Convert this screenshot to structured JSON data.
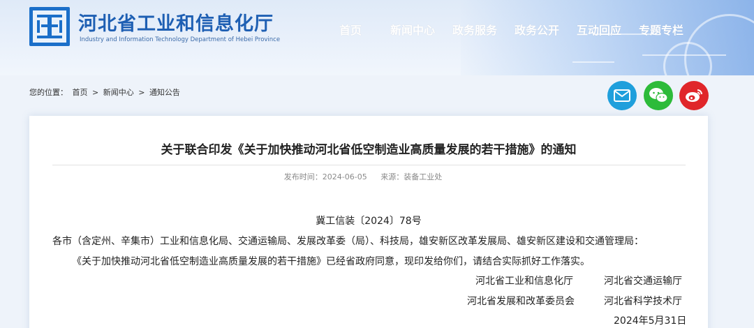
{
  "header": {
    "logo_cn": "河北省工业和信息化厅",
    "logo_en": "Industry and Information Technology Department of Hebei Province",
    "nav": [
      {
        "label": "首页"
      },
      {
        "label": "新闻中心"
      },
      {
        "label": "政务服务"
      },
      {
        "label": "政务公开"
      },
      {
        "label": "互动回应"
      },
      {
        "label": "专题专栏"
      }
    ]
  },
  "breadcrumb": {
    "prefix": "您的位置：",
    "items": [
      "首页",
      ">",
      "新闻中心",
      ">",
      "通知公告"
    ]
  },
  "share": {
    "icons": [
      "email-icon",
      "wechat-icon",
      "weibo-icon"
    ],
    "colors": {
      "email": "#1f9fdc",
      "wechat": "#2dbb3a",
      "weibo": "#e0262a"
    }
  },
  "article": {
    "title": "关于联合印发《关于加快推动河北省低空制造业高质量发展的若干措施》的通知",
    "meta": {
      "publish_label": "发布时间：",
      "publish_date": "2024-06-05",
      "source_label": "来源：",
      "source": "装备工业处"
    },
    "doc_number": "冀工信装〔2024〕78号",
    "recipients": "各市（含定州、辛集市）工业和信息化局、交通运输局、发展改革委（局）、科技局，雄安新区改革发展局、雄安新区建设和交通管理局：",
    "body": "《关于加快推动河北省低空制造业高质量发展的若干措施》已经省政府同意，现印发给你们，请结合实际抓好工作落实。",
    "signatories": [
      "河北省工业和信息化厅",
      "河北省交通运输厅",
      "河北省发展和改革委员会",
      "河北省科学技术厅"
    ],
    "date": "2024年5月31日"
  }
}
